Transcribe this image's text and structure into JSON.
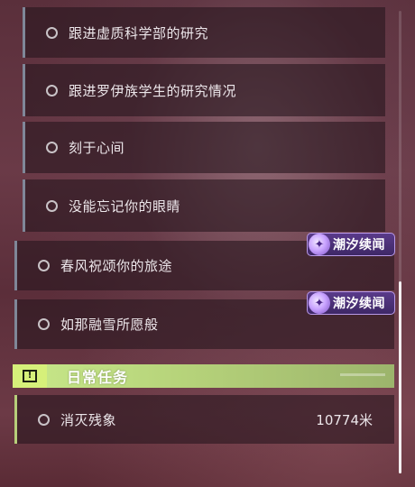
{
  "quests": [
    {
      "label": "跟进虚质科学部的研究"
    },
    {
      "label": "跟进罗伊族学生的研究情况"
    },
    {
      "label": "刻于心间"
    },
    {
      "label": "没能忘记你的眼睛"
    },
    {
      "label": "春风祝颂你的旅途"
    },
    {
      "label": "如那融雪所愿般"
    }
  ],
  "badge": {
    "text": "潮汐续闻",
    "icon": "tidal-story-icon"
  },
  "daily": {
    "section_title": "日常任务",
    "section_icon": "alert-icon",
    "quest_label": "消灭残象",
    "distance": "10774米"
  },
  "colors": {
    "daily_accent": "#c8e88a",
    "badge_purple": "#5a3a8a"
  }
}
